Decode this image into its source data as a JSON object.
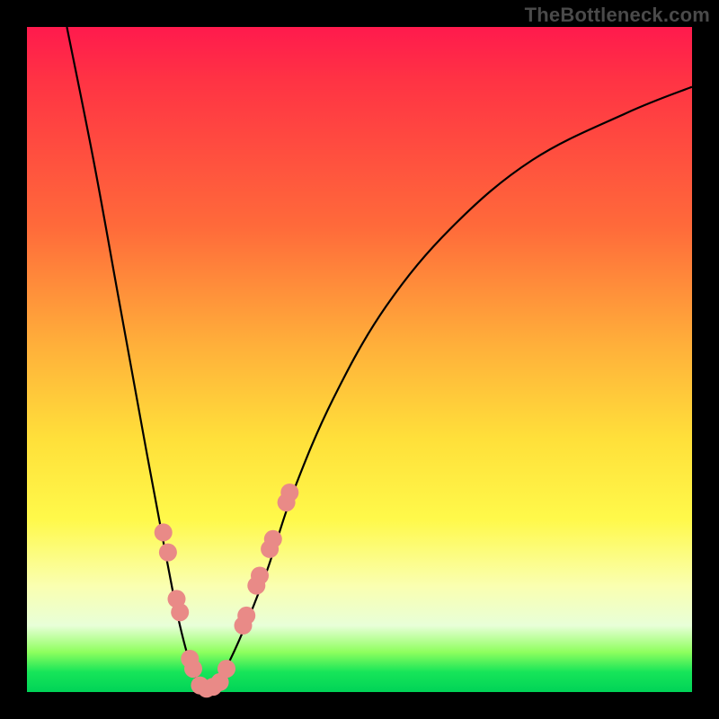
{
  "watermark": "TheBottleneck.com",
  "colors": {
    "frame": "#000000",
    "gradient_top": "#ff1a4d",
    "gradient_mid": "#ffe03a",
    "gradient_bottom": "#00d357",
    "curve": "#000000",
    "beads": "#e98a87"
  },
  "chart_data": {
    "type": "line",
    "title": "",
    "xlabel": "",
    "ylabel": "",
    "xlim": [
      0,
      100
    ],
    "ylim": [
      0,
      100
    ],
    "note": "Axes carry no tick labels; values are normalized 0–100. V-shaped bottleneck curve with minimum near x≈27.",
    "series": [
      {
        "name": "curve",
        "x": [
          6,
          10,
          14,
          18,
          21,
          23,
          25,
          27,
          29,
          32,
          36,
          40,
          46,
          54,
          64,
          76,
          90,
          100
        ],
        "y": [
          100,
          80,
          58,
          36,
          20,
          10,
          3,
          0,
          2,
          8,
          18,
          30,
          44,
          58,
          70,
          80,
          87,
          91
        ]
      }
    ],
    "markers": {
      "name": "beads",
      "note": "Salmon dot clusters along the curve near the trough on both sides.",
      "points": [
        {
          "x": 20.5,
          "y": 24
        },
        {
          "x": 21.2,
          "y": 21
        },
        {
          "x": 22.5,
          "y": 14
        },
        {
          "x": 23.0,
          "y": 12
        },
        {
          "x": 24.5,
          "y": 5
        },
        {
          "x": 25.0,
          "y": 3.5
        },
        {
          "x": 26.0,
          "y": 1
        },
        {
          "x": 27.0,
          "y": 0.5
        },
        {
          "x": 28.0,
          "y": 0.8
        },
        {
          "x": 29.0,
          "y": 1.5
        },
        {
          "x": 30.0,
          "y": 3.5
        },
        {
          "x": 32.5,
          "y": 10
        },
        {
          "x": 33.0,
          "y": 11.5
        },
        {
          "x": 34.5,
          "y": 16
        },
        {
          "x": 35.0,
          "y": 17.5
        },
        {
          "x": 36.5,
          "y": 21.5
        },
        {
          "x": 37.0,
          "y": 23
        },
        {
          "x": 39.0,
          "y": 28.5
        },
        {
          "x": 39.5,
          "y": 30
        }
      ]
    }
  }
}
